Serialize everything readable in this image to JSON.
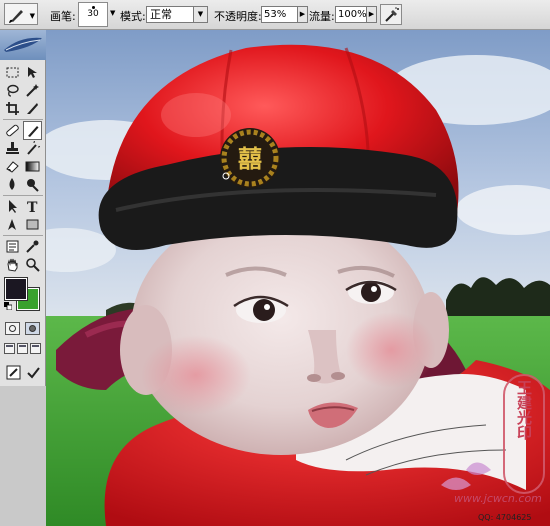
{
  "app": {
    "name": "Photoshop"
  },
  "options_bar": {
    "brush_label": "画笔:",
    "brush_size": "30",
    "mode_label": "模式:",
    "mode_value": "正常",
    "opacity_label": "不透明度:",
    "opacity_value": "53%",
    "flow_label": "流量:",
    "flow_value": "100%",
    "airbrush_icon": "airbrush-icon"
  },
  "toolbox": {
    "tools": [
      "marquee-icon",
      "move-icon",
      "lasso-icon",
      "magic-wand-icon",
      "crop-icon",
      "slice-icon",
      "healing-brush-icon",
      "brush-icon",
      "clone-stamp-icon",
      "history-brush-icon",
      "eraser-icon",
      "gradient-icon",
      "blur-icon",
      "dodge-icon",
      "path-selection-icon",
      "type-icon",
      "pen-icon",
      "shape-icon",
      "notes-icon",
      "eyedropper-icon",
      "hand-icon",
      "zoom-icon"
    ],
    "foreground_color": "#1b1722",
    "background_color": "#3aa12e",
    "type_glyph": "T"
  },
  "canvas": {
    "hat_badge_text": "囍",
    "watermark": {
      "seal_text": "王建光印",
      "site": "www.jcwcn.com",
      "qq": "QQ: 4704625"
    }
  },
  "colors": {
    "hat_red": "#e0161c",
    "hat_band": "#1a1a1a",
    "badge_gold": "#d8b23a",
    "scarf": "#7a1a3a",
    "sky": "#9bb4d4",
    "grass": "#4aa83a"
  }
}
